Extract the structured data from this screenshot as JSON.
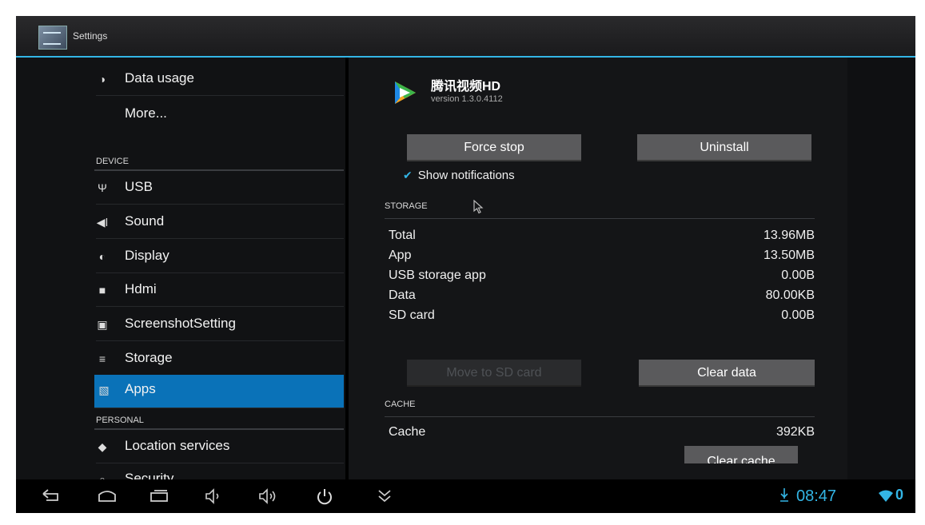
{
  "action_bar": {
    "title": "Settings",
    "icon": "settings-app-icon"
  },
  "sidebar": {
    "items_top": [
      {
        "label": "Data usage",
        "icon": "data-usage-icon"
      },
      {
        "label": "More...",
        "icon": ""
      }
    ],
    "device_header": "DEVICE",
    "device_items": [
      {
        "label": "USB",
        "icon": "usb-icon"
      },
      {
        "label": "Sound",
        "icon": "sound-icon"
      },
      {
        "label": "Display",
        "icon": "display-icon"
      },
      {
        "label": "Hdmi",
        "icon": "hdmi-icon"
      },
      {
        "label": "ScreenshotSetting",
        "icon": "camera-icon"
      },
      {
        "label": "Storage",
        "icon": "storage-icon"
      },
      {
        "label": "Apps",
        "icon": "apps-icon",
        "selected": true
      }
    ],
    "personal_header": "PERSONAL",
    "personal_items": [
      {
        "label": "Location services",
        "icon": "location-icon"
      },
      {
        "label": "Security",
        "icon": "lock-icon"
      }
    ]
  },
  "app_info": {
    "name": "腾讯视频HD",
    "version": "version 1.3.0.4112",
    "force_stop_label": "Force stop",
    "uninstall_label": "Uninstall",
    "show_notifications_label": "Show notifications",
    "show_notifications_checked": true
  },
  "storage": {
    "header": "STORAGE",
    "rows": [
      {
        "label": "Total",
        "value": "13.96MB"
      },
      {
        "label": "App",
        "value": "13.50MB"
      },
      {
        "label": "USB storage app",
        "value": "0.00B"
      },
      {
        "label": "Data",
        "value": "80.00KB"
      },
      {
        "label": "SD card",
        "value": "0.00B"
      }
    ],
    "move_label": "Move to SD card",
    "clear_data_label": "Clear data"
  },
  "cache": {
    "header": "CACHE",
    "label": "Cache",
    "value": "392KB",
    "clear_cache_label": "Clear cache"
  },
  "status_bar": {
    "time": "08:47",
    "wifi_count": "0",
    "accent": "#33b5e5"
  },
  "colors": {
    "selected": "#0a72b8",
    "accent": "#33b5e5"
  }
}
